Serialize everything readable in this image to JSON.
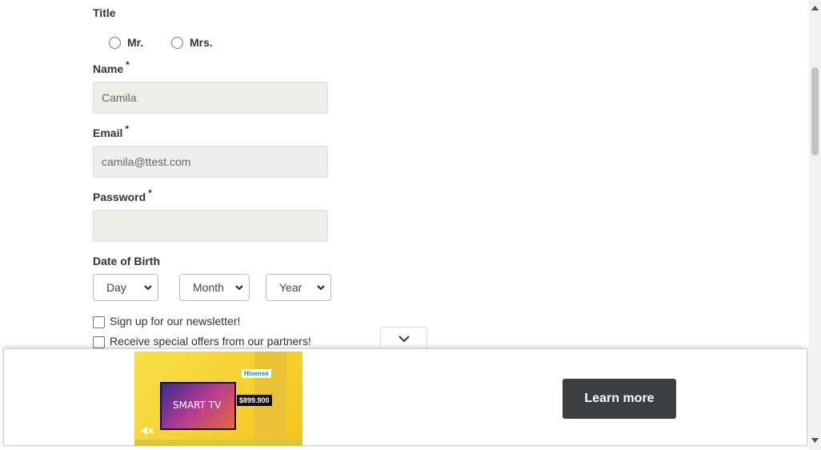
{
  "form": {
    "title_label": "Title",
    "title_options": [
      "Mr.",
      "Mrs."
    ],
    "name": {
      "label": "Name",
      "required_mark": "*",
      "value": "Camila"
    },
    "email": {
      "label": "Email",
      "required_mark": "*",
      "value": "camila@ttest.com"
    },
    "password": {
      "label": "Password",
      "required_mark": "*",
      "value": ""
    },
    "dob": {
      "label": "Date of Birth",
      "day": "Day",
      "month": "Month",
      "year": "Year"
    },
    "checkboxes": {
      "newsletter": "Sign up for our newsletter!",
      "offers": "Receive special offers from our partners!"
    }
  },
  "ad": {
    "cta_label": "Learn more",
    "brand": "Hisense",
    "tv_text": "SMART TV",
    "price": "$899.900",
    "colors": {
      "cta_bg": "#3c3f42",
      "ad_bg": "#f7e04a"
    }
  },
  "icons": {
    "collapse": "chevron-down-icon",
    "mute": "muted-speaker-icon",
    "scroll_up": "arrow-up-icon",
    "scroll_down": "arrow-down-icon"
  }
}
